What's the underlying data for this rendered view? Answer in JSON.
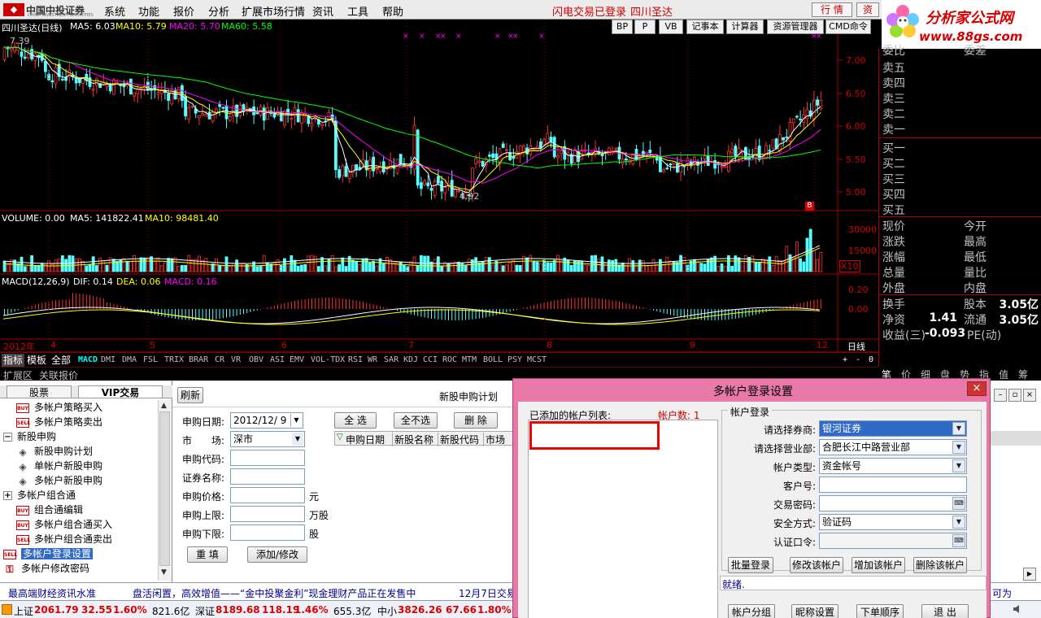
{
  "menubar": {
    "logo_text": "中国中投证券",
    "logo_sub": "CHINA INVESTMENT SECURITIES",
    "items": [
      "系统",
      "功能",
      "报价",
      "分析",
      "扩展市场行情",
      "资讯",
      "工具",
      "帮助"
    ],
    "status_login": "闪电交易已登录",
    "status_stock": "四川圣达",
    "btn_quote": "行 情",
    "btn_trade": "资"
  },
  "brand": {
    "title": "分析家公式网",
    "url": "www.88gs.com"
  },
  "chart": {
    "title": "四川圣达(日线)",
    "ma5": "MA5: 6.03",
    "ma10": "MA10: 5.79",
    "ma20": "MA20: 5.70",
    "ma60": "MA60: 5.58",
    "high_mark": "7.39",
    "low_mark": "4.92",
    "b_mark": "B",
    "price_ticks": [
      "7.00",
      "6.50",
      "6.00",
      "5.50",
      "5.00"
    ],
    "volume_label": "VOLUME: 0.00",
    "vol_ma5": "MA5: 141822.41",
    "vol_ma10": "MA10: 98481.40",
    "vol_ticks": [
      "30000",
      "15000"
    ],
    "vol_unit": "X10",
    "macd_label": "MACD(12,26,9)",
    "dif": "DIF: 0.14",
    "dea": "DEA: 0.06",
    "macd": "MACD: 0.16",
    "macd_ticks": [
      "0.20",
      "0.00"
    ],
    "date_labels": [
      "2012年",
      "4",
      "5",
      "6",
      "7",
      "8",
      "9",
      "12"
    ],
    "period": "日线",
    "toolbar": [
      "BP",
      "P",
      "VB",
      "记事本",
      "计算器",
      "资源管理器",
      "CMD命令"
    ]
  },
  "right_panel": {
    "header": [
      "委比",
      "委差"
    ],
    "sell": [
      "卖五",
      "卖四",
      "卖三",
      "卖二",
      "卖一"
    ],
    "buy": [
      "买一",
      "买二",
      "买三",
      "买四",
      "买五"
    ],
    "stats": [
      {
        "l": "现价",
        "m": "今开"
      },
      {
        "l": "涨跌",
        "m": "最高"
      },
      {
        "l": "涨幅",
        "m": "最低"
      },
      {
        "l": "总量",
        "m": "量比"
      },
      {
        "l": "外盘",
        "m": "内盘"
      },
      {
        "l": "换手",
        "m": "股本",
        "v2": "3.05亿"
      },
      {
        "l": "净资",
        "v1": "1.41",
        "m": "流通",
        "v2": "3.05亿"
      },
      {
        "l": "收益(三)",
        "v1": "-0.093",
        "m": "PE(动)"
      }
    ],
    "tabs": [
      "笔",
      "价",
      "细",
      "盘",
      "势",
      "指",
      "值",
      "筹"
    ]
  },
  "indicator_bar": {
    "tabs": [
      "指标",
      "模板",
      "全部"
    ],
    "items": [
      "MACD",
      "DMI",
      "DMA",
      "FSL",
      "TRIX",
      "BRAR",
      "CR",
      "VR",
      "OBV",
      "ASI",
      "EMV",
      "VOL-TDX",
      "RSI",
      "WR",
      "SAR",
      "KDJ",
      "CCI",
      "ROC",
      "MTM",
      "BOLL",
      "PSY",
      "MCST"
    ],
    "ctrls": [
      "+",
      "-",
      "0"
    ]
  },
  "ext_bar": [
    "扩展区",
    "关联报价"
  ],
  "left_panel": {
    "tabs": [
      "股票",
      "VIP交易"
    ],
    "tree": [
      {
        "icon": "BUY",
        "label": "多帐户策略买入",
        "indent": 1
      },
      {
        "icon": "SELL",
        "label": "多帐户策略卖出",
        "indent": 1
      },
      {
        "icon": "-",
        "label": "新股申购",
        "indent": 0
      },
      {
        "icon": "gear",
        "label": "新股申购计划",
        "indent": 1
      },
      {
        "icon": "gear",
        "label": "单帐户新股申购",
        "indent": 1
      },
      {
        "icon": "gear",
        "label": "多帐户新股申购",
        "indent": 1
      },
      {
        "icon": "+",
        "label": "多帐户组合通",
        "indent": 0
      },
      {
        "icon": "BUY",
        "label": "组合通编辑",
        "indent": 1
      },
      {
        "icon": "BUY",
        "label": "多帐户组合通买入",
        "indent": 1
      },
      {
        "icon": "SELL",
        "label": "多帐户组合通卖出",
        "indent": 1
      },
      {
        "icon": "SELL",
        "label": "多帐户登录设置",
        "indent": 0,
        "selected": true
      },
      {
        "icon": "key",
        "label": "多帐户修改密码",
        "indent": 0
      }
    ]
  },
  "form": {
    "refresh": "刷新",
    "title": "新股申购计划",
    "date_label": "申购日期:",
    "date_value": "2012/12/ 9",
    "market_label": "市　　场:",
    "market_value": "深市",
    "code_label": "申购代码:",
    "name_label": "证券名称:",
    "price_label": "申购价格:",
    "price_unit": "元",
    "upper_label": "申购上限:",
    "upper_unit": "万股",
    "lower_label": "申购下限:",
    "lower_unit": "股",
    "reset": "重 填",
    "add": "添加/修改",
    "select_all": "全 选",
    "deselect_all": "全不选",
    "delete": "删 除",
    "columns": [
      "申购日期",
      "新股名称",
      "新股代码",
      "市场"
    ]
  },
  "dialog": {
    "title": "多帐户登录设置",
    "list_label": "已添加的帐户列表:",
    "count_label": "帐户数: 1",
    "group_title": "帐户登录",
    "broker_label": "请选择券商:",
    "broker_value": "银河证券",
    "branch_label": "请选择营业部:",
    "branch_value": "合肥长江中路营业部",
    "acct_type_label": "帐户类型:",
    "acct_type_value": "资金帐号",
    "client_label": "客户号:",
    "pwd_label": "交易密码:",
    "security_label": "安全方式:",
    "security_value": "验证码",
    "auth_label": "认证口令:",
    "btn_batch": "批量登录",
    "btn_modify": "修改该帐户",
    "btn_add": "增加该帐户",
    "btn_delete": "删除该帐户",
    "status": "就绪.",
    "btn_group": "帐户分组",
    "btn_alias": "昵称设置",
    "btn_order": "下单顺序",
    "btn_exit": "退 出"
  },
  "ticker": {
    "news1": "最高端财经资讯水准",
    "news2": "盘活闲置，高效增值——“金中投聚金利”现金理财产品正在发售中",
    "news3": "12月7日交易",
    "news4": "，可为"
  },
  "indices": [
    {
      "name": "上证",
      "value": "2061.79",
      "chg": "32.55",
      "pct": "1.60%",
      "amt": "821.6亿"
    },
    {
      "name": "深证",
      "value": "8189.68",
      "chg": "118.19",
      "pct": "1.46%",
      "amt": "655.3亿"
    },
    {
      "name": "中小",
      "value": "3826.26",
      "chg": "67.66",
      "pct": "1.80%",
      "amt": ""
    }
  ]
}
